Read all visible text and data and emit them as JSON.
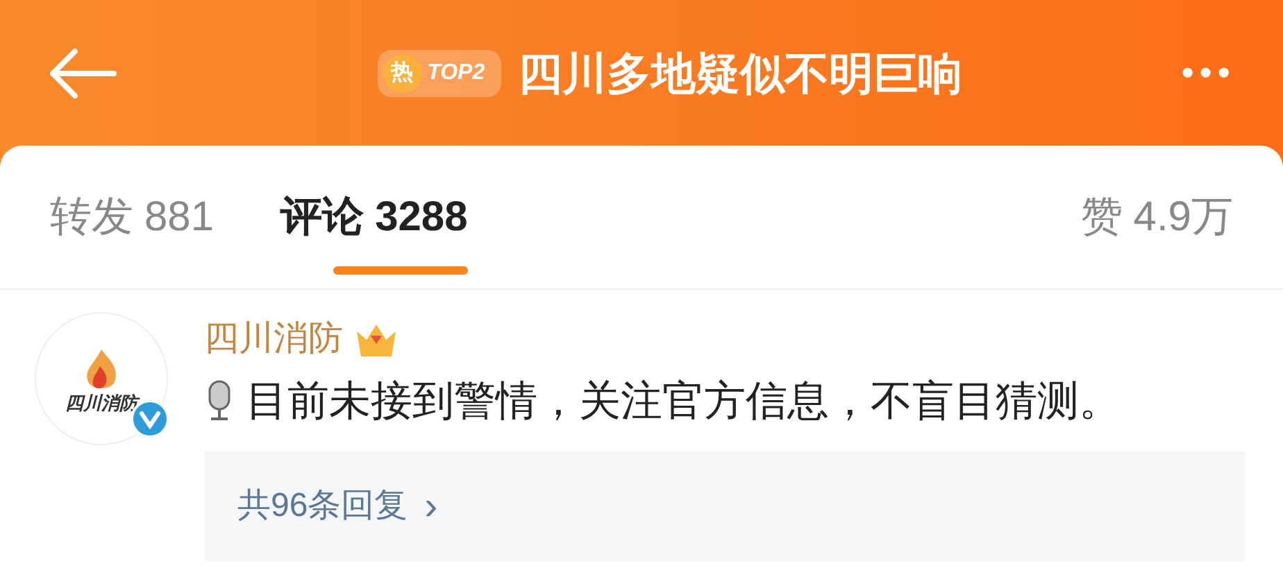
{
  "header": {
    "badge_glyph": "热",
    "badge_rank": "TOP2",
    "title": "四川多地疑似不明巨响",
    "more": "•••"
  },
  "tabs": [
    {
      "label": "转发",
      "count": "881",
      "selected": false
    },
    {
      "label": "评论",
      "count": "3288",
      "selected": true
    }
  ],
  "likes": {
    "label": "赞",
    "count": "4.9万"
  },
  "comment": {
    "author": "四川消防",
    "avatar_text": "四川消防",
    "verified": true,
    "text": "目前未接到警情，关注官方信息，不盲目猜测。",
    "replies": "共96条回复",
    "replies_arrow": "›"
  }
}
